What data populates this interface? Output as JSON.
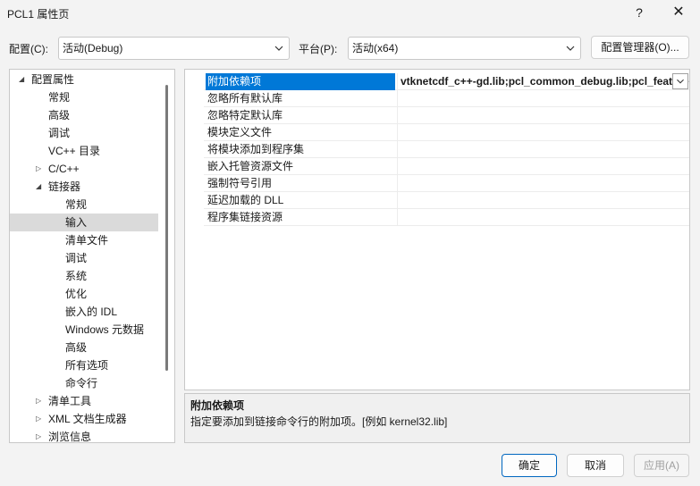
{
  "window": {
    "title": "PCL1 属性页",
    "help_glyph": "?",
    "close_glyph": "✕"
  },
  "toolbar": {
    "config_label": "配置(C):",
    "config_value": "活动(Debug)",
    "platform_label": "平台(P):",
    "platform_value": "活动(x64)",
    "config_manager_label": "配置管理器(O)..."
  },
  "tree": {
    "items": [
      {
        "label": "配置属性",
        "arrow": "expanded"
      },
      {
        "label": "常规"
      },
      {
        "label": "高级"
      },
      {
        "label": "调试"
      },
      {
        "label": "VC++ 目录"
      },
      {
        "label": "C/C++",
        "arrow": "collapsed"
      },
      {
        "label": "链接器",
        "arrow": "expanded"
      },
      {
        "label": "常规"
      },
      {
        "label": "输入",
        "selected": true
      },
      {
        "label": "清单文件"
      },
      {
        "label": "调试"
      },
      {
        "label": "系统"
      },
      {
        "label": "优化"
      },
      {
        "label": "嵌入的 IDL"
      },
      {
        "label": "Windows 元数据"
      },
      {
        "label": "高级"
      },
      {
        "label": "所有选项"
      },
      {
        "label": "命令行"
      },
      {
        "label": "清单工具",
        "arrow": "collapsed"
      },
      {
        "label": "XML 文档生成器",
        "arrow": "collapsed"
      },
      {
        "label": "浏览信息",
        "arrow": "collapsed"
      }
    ]
  },
  "grid": {
    "rows": [
      {
        "name": "附加依赖项",
        "value": "vtknetcdf_c++-gd.lib;pcl_common_debug.lib;pcl_features_debug.lib",
        "selected": true
      },
      {
        "name": "忽略所有默认库",
        "value": ""
      },
      {
        "name": "忽略特定默认库",
        "value": ""
      },
      {
        "name": "模块定义文件",
        "value": ""
      },
      {
        "name": "将模块添加到程序集",
        "value": ""
      },
      {
        "name": "嵌入托管资源文件",
        "value": ""
      },
      {
        "name": "强制符号引用",
        "value": ""
      },
      {
        "name": "延迟加载的 DLL",
        "value": ""
      },
      {
        "name": "程序集链接资源",
        "value": ""
      }
    ]
  },
  "description": {
    "title": "附加依赖项",
    "text": "指定要添加到链接命令行的附加项。[例如 kernel32.lib]"
  },
  "buttons": {
    "ok": "确定",
    "cancel": "取消",
    "apply": "应用(A)"
  },
  "colors": {
    "selection_blue": "#0078d7",
    "tree_selection": "#dadada"
  }
}
